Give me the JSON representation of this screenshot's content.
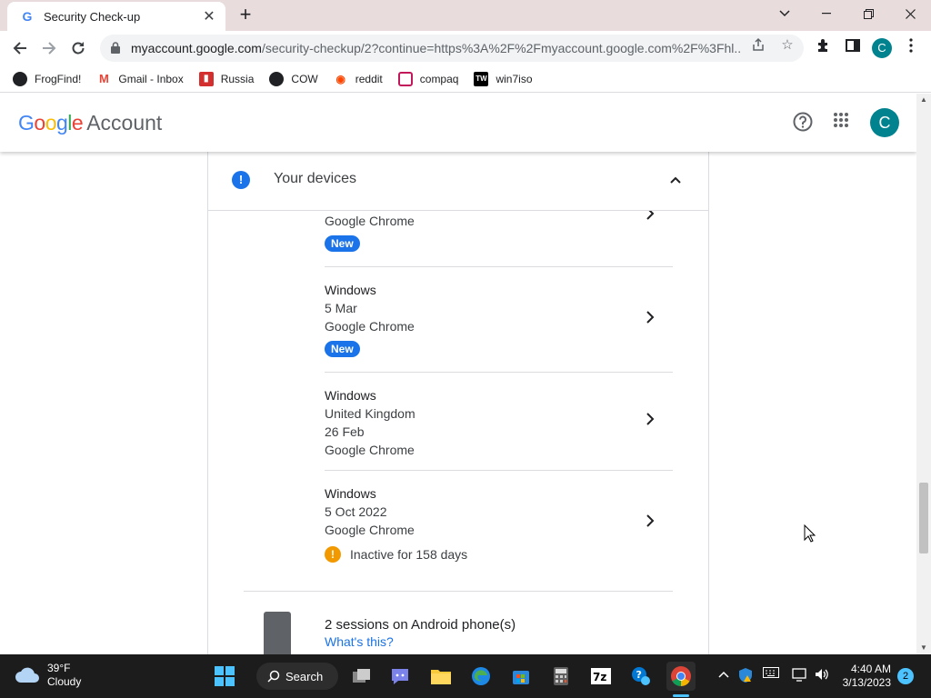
{
  "browser": {
    "tab_title": "Security Check-up",
    "url_host": "myaccount.google.com",
    "url_path": "/security-checkup/2?continue=https%3A%2F%2Fmyaccount.google.com%2F%3Fhl...",
    "profile_initial": "C"
  },
  "bookmarks": [
    {
      "label": "FrogFind!",
      "icon": "globe-icon"
    },
    {
      "label": "Gmail - Inbox",
      "icon": "gmail-icon"
    },
    {
      "label": "Russia",
      "icon": "flag-icon"
    },
    {
      "label": "COW",
      "icon": "globe-icon"
    },
    {
      "label": "reddit",
      "icon": "reddit-icon"
    },
    {
      "label": "compaq",
      "icon": "compaq-icon"
    },
    {
      "label": "win7iso",
      "icon": "tw-icon"
    }
  ],
  "header": {
    "logo_text": "Google",
    "account_text": "Account",
    "avatar_initial": "C"
  },
  "section": {
    "title": "Your devices",
    "info_glyph": "!"
  },
  "devices": [
    {
      "lines": [
        "Google Chrome"
      ],
      "badge": "New"
    },
    {
      "name": "Windows",
      "lines": [
        "5 Mar",
        "Google Chrome"
      ],
      "badge": "New"
    },
    {
      "name": "Windows",
      "lines": [
        "United Kingdom",
        "26 Feb",
        "Google Chrome"
      ]
    },
    {
      "name": "Windows",
      "lines": [
        "5 Oct 2022",
        "Google Chrome"
      ],
      "warning": "Inactive for 158 days"
    }
  ],
  "android": {
    "title": "2 sessions on Android phone(s)",
    "link": "What's this?"
  },
  "taskbar": {
    "temp": "39°F",
    "condition": "Cloudy",
    "search_label": "Search",
    "time": "4:40 AM",
    "date": "3/13/2023",
    "notifications": "2"
  },
  "colors": {
    "accent": "#1a73e8",
    "avatar": "#00838f",
    "warning": "#f29900"
  }
}
